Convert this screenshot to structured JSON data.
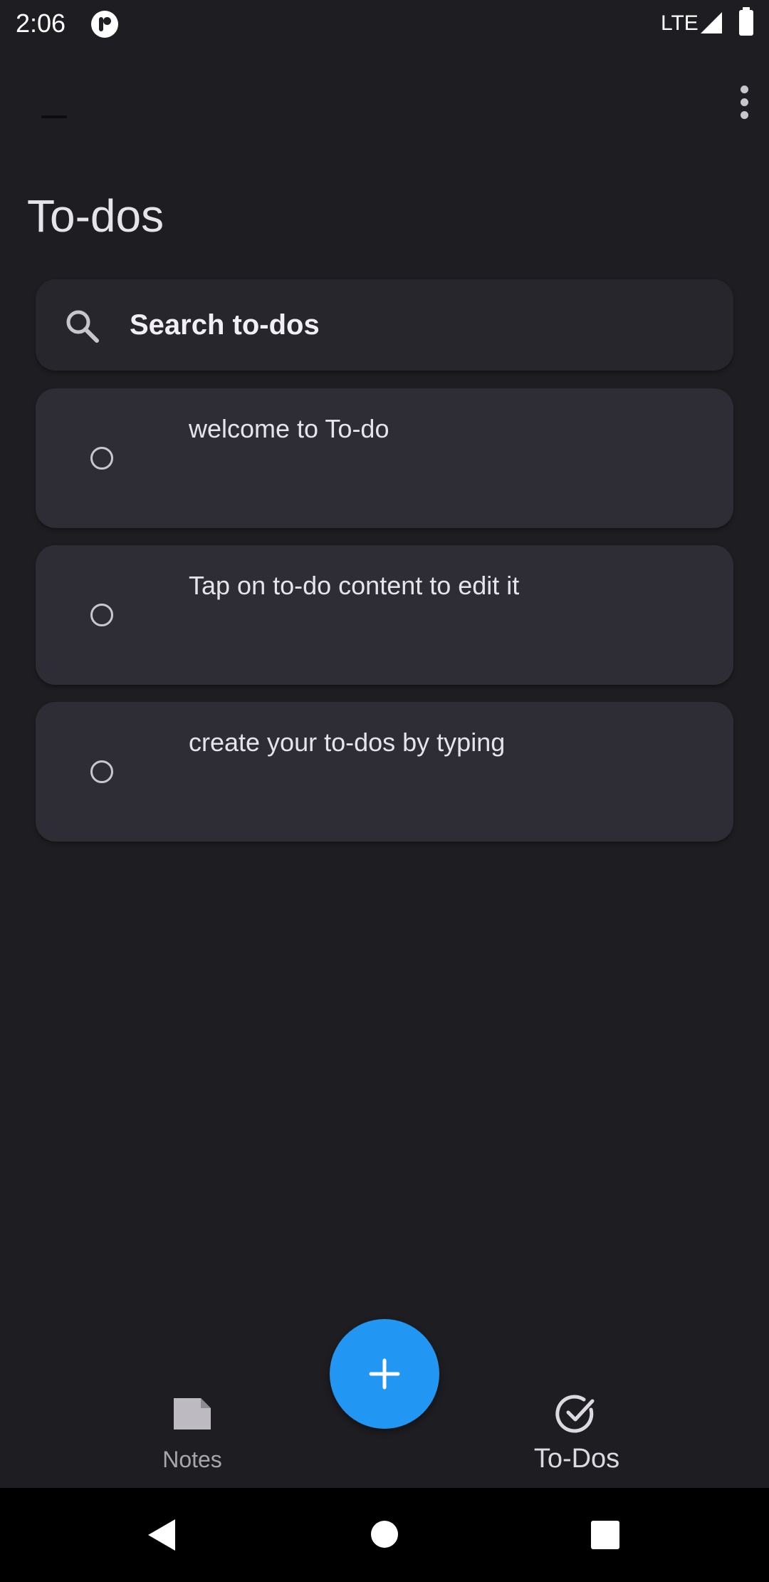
{
  "status_bar": {
    "time": "2:06",
    "network": "LTE",
    "app_icon": "pocket-casts-icon",
    "signal_icon": "cell-signal-icon",
    "battery_icon": "battery-icon"
  },
  "app_bar": {
    "title": "To-dos",
    "menu_icon": "more-vert-icon"
  },
  "search": {
    "placeholder": "Search to-dos",
    "icon": "search-icon"
  },
  "todos": [
    {
      "text": "welcome to To-do",
      "done": false
    },
    {
      "text": "Tap on to-do content to edit it",
      "done": false
    },
    {
      "text": "create your to-dos by typing",
      "done": false
    }
  ],
  "fab": {
    "icon": "add-icon",
    "color": "#2196f3"
  },
  "bottom_nav": {
    "items": [
      {
        "label": "Notes",
        "icon": "note-icon",
        "selected": false
      },
      {
        "label": "To-Dos",
        "icon": "check-circle-icon",
        "selected": true
      }
    ]
  },
  "system_nav": {
    "back_icon": "back-icon",
    "home_icon": "home-icon",
    "recents_icon": "recents-icon"
  },
  "colors": {
    "background": "#1e1e22",
    "card": "#2e2d36",
    "accent": "#2196f3",
    "text": "#e6e3ea"
  }
}
